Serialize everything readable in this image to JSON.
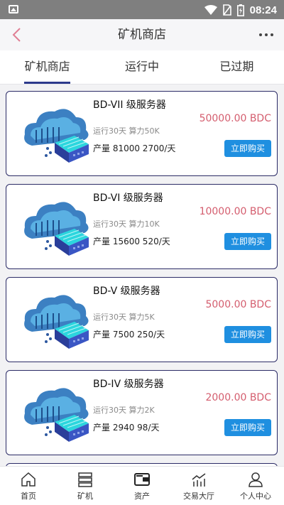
{
  "status_bar": {
    "time": "08:24",
    "icons": [
      "image-icon",
      "wifi-icon",
      "no-sim-icon",
      "battery-charging-icon"
    ]
  },
  "nav": {
    "back_icon": "chevron-left-icon",
    "title": "矿机商店",
    "more_icon": "more-horizontal-icon"
  },
  "tabs": [
    {
      "label": "矿机商店",
      "active": true
    },
    {
      "label": "运行中",
      "active": false
    },
    {
      "label": "已过期",
      "active": false
    }
  ],
  "products": [
    {
      "name": "BD-VII 级服务器",
      "price": "50000.00 BDC",
      "meta": "运行30天 算力50K",
      "output": "产量 81000   2700/天",
      "buy_label": "立即购买"
    },
    {
      "name": "BD-VI 级服务器",
      "price": "10000.00 BDC",
      "meta": "运行30天 算力10K",
      "output": "产量 15600   520/天",
      "buy_label": "立即购买"
    },
    {
      "name": "BD-V 级服务器",
      "price": "5000.00 BDC",
      "meta": "运行30天 算力5K",
      "output": "产量 7500   250/天",
      "buy_label": "立即购买"
    },
    {
      "name": "BD-IV 级服务器",
      "price": "2000.00 BDC",
      "meta": "运行30天 算力2K",
      "output": "产量 2940   98/天",
      "buy_label": "立即购买"
    }
  ],
  "bottom_nav": [
    {
      "label": "首页",
      "icon": "home-icon"
    },
    {
      "label": "矿机",
      "icon": "server-icon"
    },
    {
      "label": "资产",
      "icon": "wallet-icon"
    },
    {
      "label": "交易大厅",
      "icon": "chart-icon"
    },
    {
      "label": "个人中心",
      "icon": "user-icon"
    }
  ],
  "colors": {
    "accent_tab": "#2d3a8c",
    "price": "#d45d6e",
    "buy_button": "#1f8fe0",
    "card_border": "#2b2b66",
    "back_icon": "#e07f94"
  }
}
